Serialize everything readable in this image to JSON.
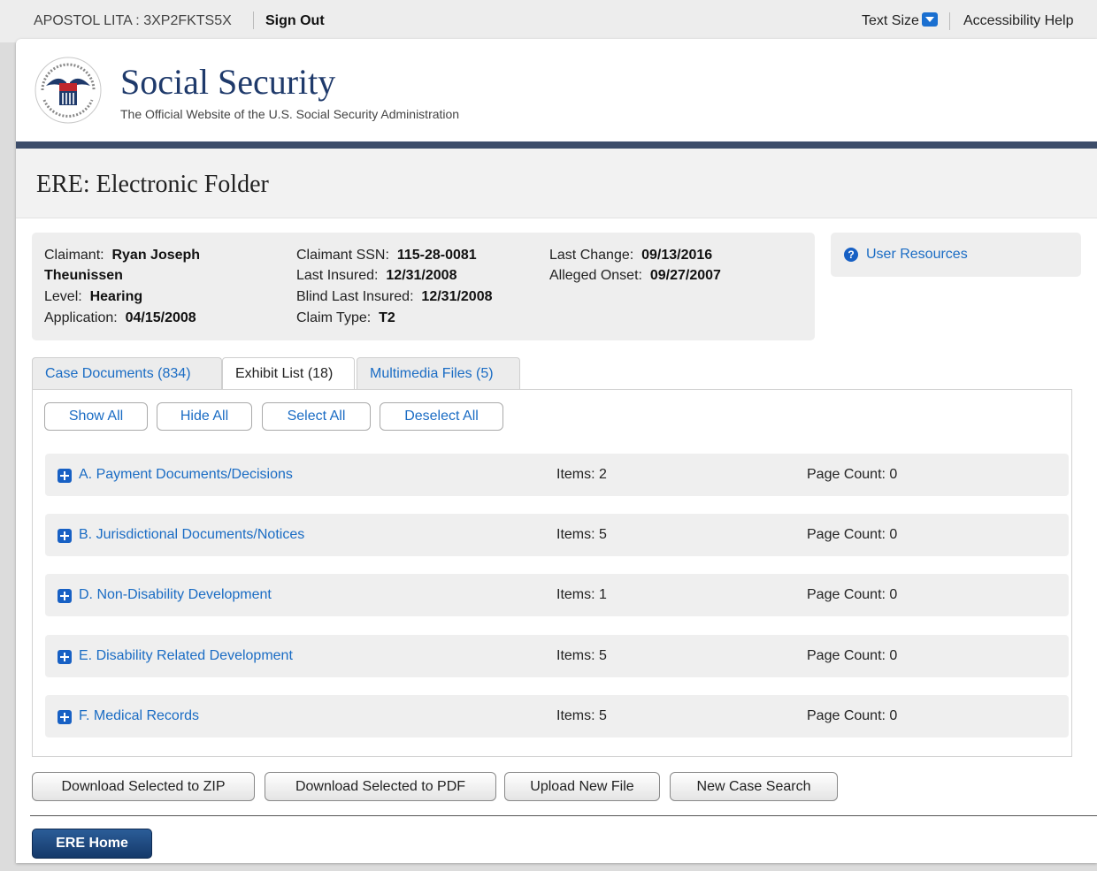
{
  "topbar": {
    "user": "APOSTOL LITA : 3XP2FKTS5X",
    "sign_out": "Sign Out",
    "text_size": "Text Size",
    "accessibility": "Accessibility Help"
  },
  "header": {
    "brand_title": "Social Security",
    "brand_subtitle": "The Official Website of the U.S. Social Security Administration",
    "logo_text": "SOCIAL SECURITY ADMINISTRATION USA",
    "page_title": "ERE: Electronic Folder"
  },
  "claimant": {
    "name_label": "Claimant:",
    "name_first": "Ryan Joseph",
    "name_last": "Theunissen",
    "level_label": "Level:",
    "level": "Hearing",
    "application_label": "Application:",
    "application": "04/15/2008",
    "ssn_label": "Claimant SSN:",
    "ssn": "115-28-0081",
    "last_insured_label": "Last Insured:",
    "last_insured": "12/31/2008",
    "blind_label": "Blind Last Insured:",
    "blind_last_insured": "12/31/2008",
    "claim_type_label": "Claim Type:",
    "claim_type": "T2",
    "last_change_label": "Last Change:",
    "last_change": "09/13/2016",
    "alleged_onset_label": "Alleged Onset:",
    "alleged_onset": "09/27/2007"
  },
  "resources": {
    "label": "User Resources"
  },
  "tabs": [
    {
      "label": "Case Documents (834)",
      "active": false
    },
    {
      "label": "Exhibit List (18)",
      "active": true
    },
    {
      "label": "Multimedia Files (5)",
      "active": false
    }
  ],
  "panel_buttons": {
    "show_all": "Show All",
    "hide_all": "Hide All",
    "select_all": "Select All",
    "deselect_all": "Deselect All"
  },
  "groups": [
    {
      "name": "A. Payment Documents/Decisions",
      "items": "Items: 2",
      "pages": "Page Count: 0"
    },
    {
      "name": "B. Jurisdictional Documents/Notices",
      "items": "Items: 5",
      "pages": "Page Count: 0"
    },
    {
      "name": "D. Non-Disability Development",
      "items": "Items: 1",
      "pages": "Page Count: 0"
    },
    {
      "name": "E. Disability Related Development",
      "items": "Items: 5",
      "pages": "Page Count: 0"
    },
    {
      "name": "F. Medical Records",
      "items": "Items: 5",
      "pages": "Page Count: 0"
    }
  ],
  "actions": {
    "zip": "Download Selected to ZIP",
    "pdf": "Download Selected to PDF",
    "upload": "Upload New File",
    "new_search": "New Case Search"
  },
  "footer": {
    "home": "ERE Home"
  },
  "colors": {
    "link": "#1a6cc4",
    "brand_rule": "#3d4d6a",
    "home_button": "#15396a",
    "icon_blue": "#1760c4"
  }
}
